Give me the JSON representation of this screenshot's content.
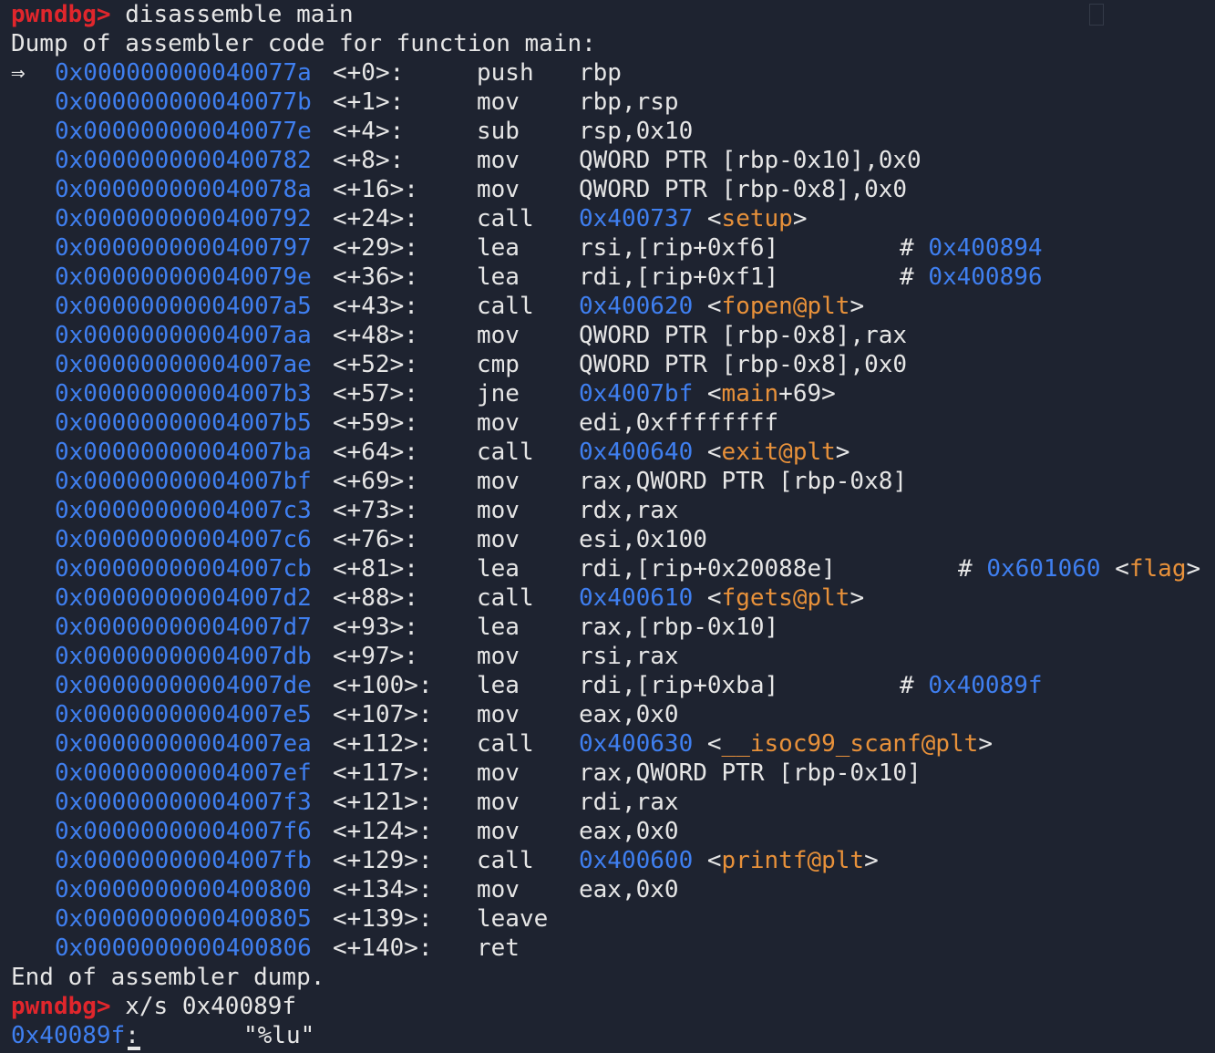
{
  "session": {
    "prompt": "pwndbg>",
    "command1": "disassemble main",
    "dump_header": "Dump of assembler code for function main:",
    "current_arrow": "⇒",
    "dump_footer": "End of assembler dump.",
    "command2": "x/s 0x40089f",
    "xs_result_addr": "0x40089f",
    "xs_result_colon": ":",
    "xs_result_value": "\"%lu\""
  },
  "instructions": [
    {
      "addr": "0x000000000040077a",
      "off": "<+0>:",
      "mn": "push",
      "op": "rbp",
      "cur": true
    },
    {
      "addr": "0x000000000040077b",
      "off": "<+1>:",
      "mn": "mov",
      "op": "rbp,rsp"
    },
    {
      "addr": "0x000000000040077e",
      "off": "<+4>:",
      "mn": "sub",
      "op": "rsp,0x10"
    },
    {
      "addr": "0x0000000000400782",
      "off": "<+8>:",
      "mn": "mov",
      "op": "QWORD PTR [rbp-0x10],0x0"
    },
    {
      "addr": "0x000000000040078a",
      "off": "<+16>:",
      "mn": "mov",
      "op": "QWORD PTR [rbp-0x8],0x0"
    },
    {
      "addr": "0x0000000000400792",
      "off": "<+24>:",
      "mn": "call",
      "target": "0x400737",
      "sym": "setup"
    },
    {
      "addr": "0x0000000000400797",
      "off": "<+29>:",
      "mn": "lea",
      "op": "rsi,[rip+0xf6]",
      "comment": "0x400894"
    },
    {
      "addr": "0x000000000040079e",
      "off": "<+36>:",
      "mn": "lea",
      "op": "rdi,[rip+0xf1]",
      "comment": "0x400896"
    },
    {
      "addr": "0x00000000004007a5",
      "off": "<+43>:",
      "mn": "call",
      "target": "0x400620",
      "sym": "fopen@plt"
    },
    {
      "addr": "0x00000000004007aa",
      "off": "<+48>:",
      "mn": "mov",
      "op": "QWORD PTR [rbp-0x8],rax"
    },
    {
      "addr": "0x00000000004007ae",
      "off": "<+52>:",
      "mn": "cmp",
      "op": "QWORD PTR [rbp-0x8],0x0"
    },
    {
      "addr": "0x00000000004007b3",
      "off": "<+57>:",
      "mn": "jne",
      "target": "0x4007bf",
      "sym": "main",
      "sym_offset": "+69"
    },
    {
      "addr": "0x00000000004007b5",
      "off": "<+59>:",
      "mn": "mov",
      "op": "edi,0xffffffff"
    },
    {
      "addr": "0x00000000004007ba",
      "off": "<+64>:",
      "mn": "call",
      "target": "0x400640",
      "sym": "exit@plt"
    },
    {
      "addr": "0x00000000004007bf",
      "off": "<+69>:",
      "mn": "mov",
      "op": "rax,QWORD PTR [rbp-0x8]"
    },
    {
      "addr": "0x00000000004007c3",
      "off": "<+73>:",
      "mn": "mov",
      "op": "rdx,rax"
    },
    {
      "addr": "0x00000000004007c6",
      "off": "<+76>:",
      "mn": "mov",
      "op": "esi,0x100"
    },
    {
      "addr": "0x00000000004007cb",
      "off": "<+81>:",
      "mn": "lea",
      "op": "rdi,[rip+0x20088e]",
      "comment": "0x601060",
      "comment_sym": "flag"
    },
    {
      "addr": "0x00000000004007d2",
      "off": "<+88>:",
      "mn": "call",
      "target": "0x400610",
      "sym": "fgets@plt"
    },
    {
      "addr": "0x00000000004007d7",
      "off": "<+93>:",
      "mn": "lea",
      "op": "rax,[rbp-0x10]"
    },
    {
      "addr": "0x00000000004007db",
      "off": "<+97>:",
      "mn": "mov",
      "op": "rsi,rax"
    },
    {
      "addr": "0x00000000004007de",
      "off": "<+100>:",
      "mn": "lea",
      "op": "rdi,[rip+0xba]",
      "comment": "0x40089f"
    },
    {
      "addr": "0x00000000004007e5",
      "off": "<+107>:",
      "mn": "mov",
      "op": "eax,0x0"
    },
    {
      "addr": "0x00000000004007ea",
      "off": "<+112>:",
      "mn": "call",
      "target": "0x400630",
      "sym": "__isoc99_scanf@plt"
    },
    {
      "addr": "0x00000000004007ef",
      "off": "<+117>:",
      "mn": "mov",
      "op": "rax,QWORD PTR [rbp-0x10]"
    },
    {
      "addr": "0x00000000004007f3",
      "off": "<+121>:",
      "mn": "mov",
      "op": "rdi,rax"
    },
    {
      "addr": "0x00000000004007f6",
      "off": "<+124>:",
      "mn": "mov",
      "op": "eax,0x0"
    },
    {
      "addr": "0x00000000004007fb",
      "off": "<+129>:",
      "mn": "call",
      "target": "0x400600",
      "sym": "printf@plt"
    },
    {
      "addr": "0x0000000000400800",
      "off": "<+134>:",
      "mn": "mov",
      "op": "eax,0x0"
    },
    {
      "addr": "0x0000000000400805",
      "off": "<+139>:",
      "mn": "leave"
    },
    {
      "addr": "0x0000000000400806",
      "off": "<+140>:",
      "mn": "ret"
    }
  ],
  "colors": {
    "background": "#1e2330",
    "prompt": "#e0262c",
    "address": "#3f7ff0",
    "symbol": "#e8913a",
    "text": "#e6e6e6"
  }
}
